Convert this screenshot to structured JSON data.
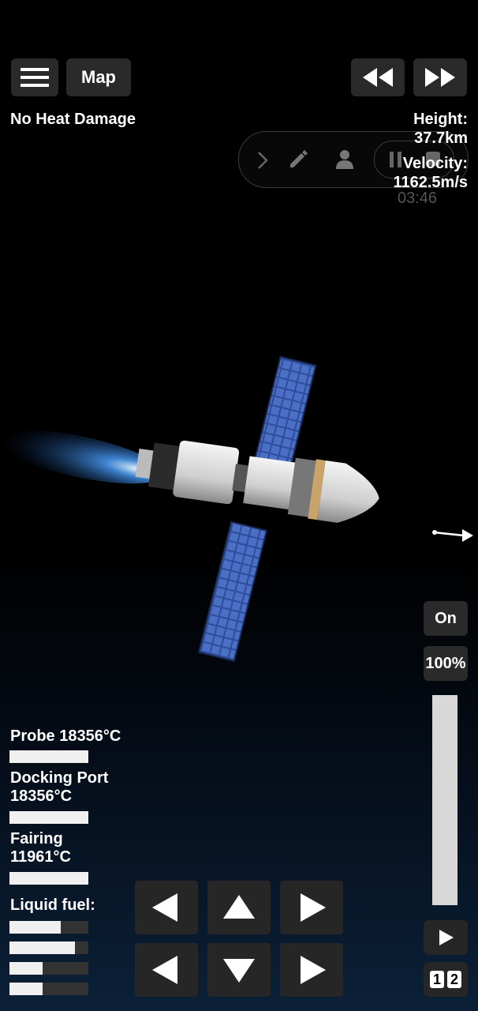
{
  "menu": {
    "icon": "hamburger-menu-icon"
  },
  "map_button": {
    "label": "Map"
  },
  "time_controls": {
    "rewind_icon": "rewind-icon",
    "fast_forward_icon": "fast-forward-icon"
  },
  "status": {
    "heat_message": "No Heat Damage"
  },
  "telemetry": {
    "height_label": "Height:",
    "height_value": "37.7km",
    "velocity_label": "Velocity:",
    "velocity_value": "1162.5m/s",
    "timer": "03:46"
  },
  "screen_recorder": {
    "icons": [
      "chevron-right-icon",
      "pencil-icon",
      "person-icon",
      "pause-icon",
      "stop-icon"
    ]
  },
  "engine": {
    "toggle_label": "On",
    "throttle_label": "100%",
    "throttle_level": 1.0
  },
  "temperatures": [
    {
      "line1": "Probe 18356°C",
      "line2": "",
      "level": 1.0
    },
    {
      "line1": "Docking Port",
      "line2": "18356°C",
      "level": 1.0
    },
    {
      "line1": "Fairing",
      "line2": "11961°C",
      "level": 1.0
    }
  ],
  "fuel": {
    "label": "Liquid fuel:",
    "tanks": [
      0.65,
      0.83,
      0.42,
      0.42
    ]
  },
  "controls": {
    "top_row": [
      "rotate-left-icon",
      "thrust-up-icon",
      "rotate-right-icon"
    ],
    "bottom_row": [
      "move-left-icon",
      "thrust-down-icon",
      "move-right-icon"
    ]
  },
  "side": {
    "play_icon": "play-icon",
    "stage_1": "1",
    "stage_2": "2"
  }
}
